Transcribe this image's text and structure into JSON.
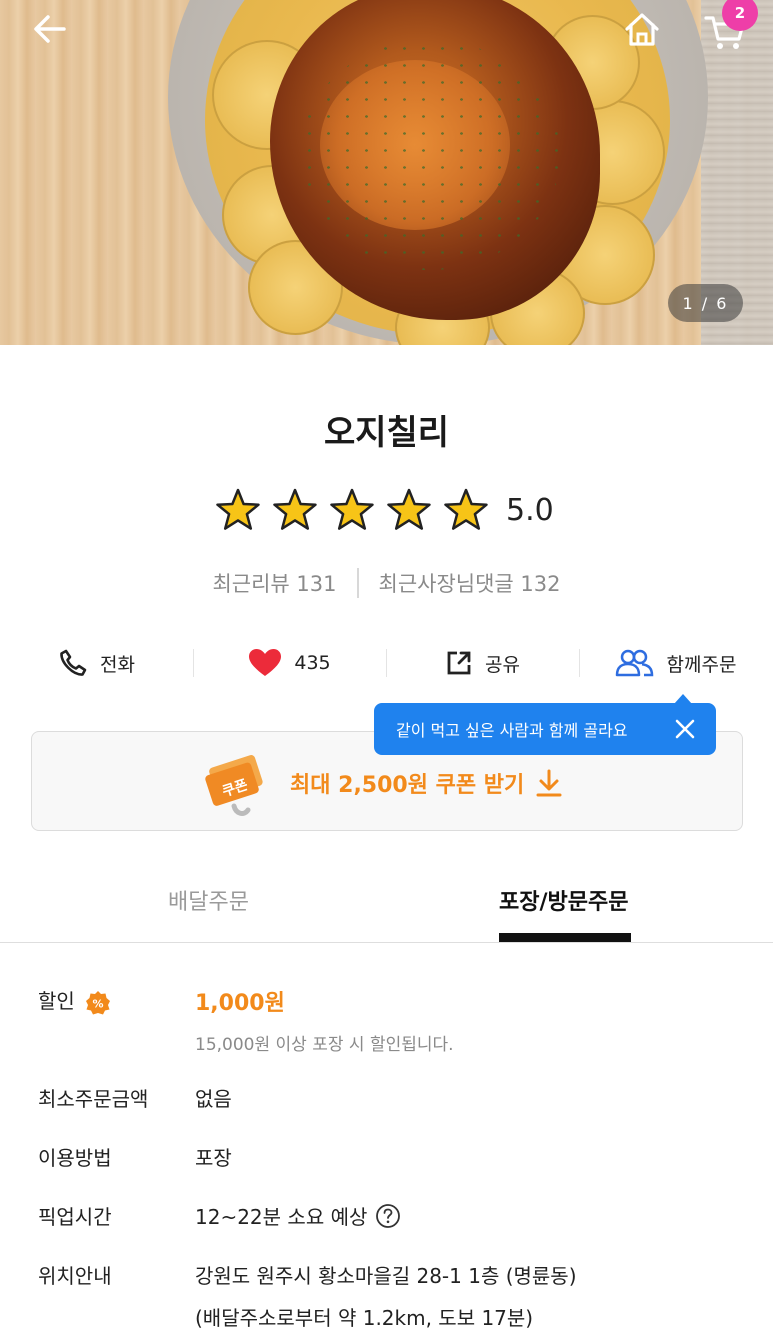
{
  "hero": {
    "pager": "1 / 6",
    "cart_count": "2"
  },
  "store": {
    "name": "오지칠리",
    "rating": "5.0",
    "stars": 5,
    "recent_reviews": "최근리뷰 131",
    "recent_owner_replies": "최근사장님댓글 132"
  },
  "actions": {
    "call": "전화",
    "likes": "435",
    "share": "공유",
    "group_order": "함께주문"
  },
  "tooltip": {
    "text": "같이 먹고 싶은 사람과 함께 골라요"
  },
  "coupon": {
    "badge": "쿠폰",
    "text": "최대 2,500원 쿠폰 받기"
  },
  "tabs": [
    {
      "label": "배달주문",
      "active": false
    },
    {
      "label": "포장/방문주문",
      "active": true
    }
  ],
  "info": {
    "discount_label": "할인",
    "discount_value": "1,000원",
    "discount_note": "15,000원 이상 포장 시 할인됩니다.",
    "min_order_label": "최소주문금액",
    "min_order_value": "없음",
    "method_label": "이용방법",
    "method_value": "포장",
    "pickup_label": "픽업시간",
    "pickup_value": "12~22분 소요 예상",
    "location_label": "위치안내",
    "location_value": "강원도 원주시 황소마을길 28-1 1층 (명륜동)",
    "location_note": "(배달주소로부터 약 1.2km, 도보 17분)"
  },
  "colors": {
    "accent_orange": "#f28a1b",
    "tooltip_blue": "#1f82ee",
    "badge_pink": "#ee3ea8",
    "heart_red": "#ec2b3a",
    "group_icon_blue": "#2e6de0"
  }
}
